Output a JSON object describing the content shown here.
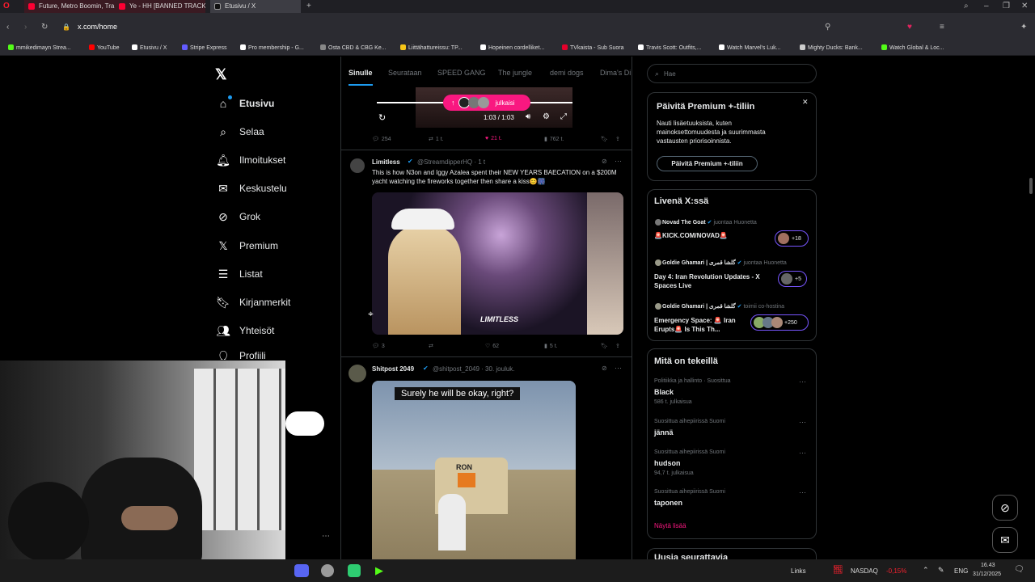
{
  "browser": {
    "tabs": [
      {
        "title": "Future, Metro Boomin, Tra",
        "color": "#e0245e"
      },
      {
        "title": "Ye - HH [BANNED TRACK]",
        "color": "#e0245e"
      },
      {
        "title": "Etusivu / X",
        "color": "#ffffff"
      }
    ],
    "url": "x.com/home",
    "bookmarks": [
      {
        "label": "mmikedimayn Strea...",
        "color": "#53fc18"
      },
      {
        "label": "YouTube",
        "color": "#ff0000"
      },
      {
        "label": "Etusivu / X",
        "color": "#ffffff"
      },
      {
        "label": "Stripe Express",
        "color": "#635bff"
      },
      {
        "label": "Pro membership - G...",
        "color": "#ffffff"
      },
      {
        "label": "Osta CBD & CBG Ke...",
        "color": "#888888"
      },
      {
        "label": "Liittähattureissu: TP...",
        "color": "#f5c518"
      },
      {
        "label": "Hopeinen cordelliket...",
        "color": "#ffffff"
      },
      {
        "label": "TVkaista - Sub Suora",
        "color": "#e4002b"
      },
      {
        "label": "Travis Scott: Outfits,...",
        "color": "#ffffff"
      },
      {
        "label": "Watch Marvel's Luk...",
        "color": "#ffffff"
      },
      {
        "label": "Mighty Ducks: Bank...",
        "color": "#cccccc"
      },
      {
        "label": "Watch Global & Loc...",
        "color": "#53fc18"
      }
    ]
  },
  "nav": {
    "items": [
      {
        "label": "Etusivu",
        "icon": "home-icon"
      },
      {
        "label": "Selaa",
        "icon": "search-icon"
      },
      {
        "label": "Ilmoitukset",
        "icon": "bell-icon"
      },
      {
        "label": "Keskustelu",
        "icon": "mail-icon"
      },
      {
        "label": "Grok",
        "icon": "grok-icon"
      },
      {
        "label": "Premium",
        "icon": "x-icon"
      },
      {
        "label": "Listat",
        "icon": "list-icon"
      },
      {
        "label": "Kirjanmerkit",
        "icon": "bookmark-icon"
      },
      {
        "label": "Yhteisöt",
        "icon": "people-icon"
      },
      {
        "label": "Profiili",
        "icon": "person-icon"
      }
    ]
  },
  "feed": {
    "tabs": [
      "Sinulle",
      "Seurataan",
      "SPEED GANG",
      "The jungle",
      "demi dogs",
      "Dima's Di"
    ],
    "video": {
      "posted_pill": "julkaisi",
      "time": "1:03 / 1:03",
      "replies": "254",
      "reposts": "1 t.",
      "likes": "21 t.",
      "views": "762 t."
    },
    "post1": {
      "name": "Limitless",
      "handle": "@StreamdipperHQ · 1 t",
      "text": "This is how N3on and Iggy Azalea spent their NEW YEARS BAECATION on a $200M yacht watching the fireworks together then share a kiss😊🎆",
      "image_caption": "LIMITLESS",
      "replies": "3",
      "reposts": "",
      "likes": "62",
      "views": "5 t."
    },
    "post2": {
      "name": "Shitpost 2049",
      "handle": "@shitpost_2049 · 30. jouluk.",
      "image_caption": "Surely he will be okay, right?",
      "truck_label": "RON"
    }
  },
  "sidebar": {
    "search_placeholder": "Hae",
    "premium": {
      "title": "Päivitä Premium +-tiliin",
      "body": "Nauti lisäetuuksista, kuten mainoksettomuudesta ja suurimmasta vastausten priorisoinnista.",
      "button": "Päivitä Premium +-tiliin"
    },
    "live": {
      "title": "Livenä X:ssä",
      "items": [
        {
          "host": "Novad The Goat",
          "role": "juontaa Huonetta",
          "title": "🚨KICK.COM/NOVAD🚨",
          "count": "+18"
        },
        {
          "host": "Goldie Ghamari | گلشا قمری",
          "role": "juontaa Huonetta",
          "title": "Day 4: Iran Revolution Updates - X Spaces Live",
          "count": "+5"
        },
        {
          "host": "Goldie Ghamari | گلشا قمری",
          "role": "toimii co-hostina",
          "title": "Emergency Space: 🚨 Iran Erupts🚨 Is This Th...",
          "count": "+250"
        }
      ]
    },
    "trends": {
      "title": "Mitä on tekeillä",
      "items": [
        {
          "meta": "Politiikka ja hallinto · Suosittua",
          "name": "Black",
          "count": "586 t. julkaisua"
        },
        {
          "meta": "Suosittua aihepiirissä Suomi",
          "name": "jännä",
          "count": ""
        },
        {
          "meta": "Suosittua aihepiirissä Suomi",
          "name": "hudson",
          "count": "94,7 t. julkaisua"
        },
        {
          "meta": "Suosittua aihepiirissä Suomi",
          "name": "taponen",
          "count": ""
        }
      ],
      "show_more": "Näytä lisää"
    },
    "next_heading": "Uusia seurattavia"
  },
  "taskbar": {
    "links": "Links",
    "ticker": "NASDAQ",
    "ticker_change": "-0,15%",
    "lang": "ENG",
    "time": "16.43",
    "date": "31/12/2025"
  },
  "colors": {
    "accent": "#1d9bf0",
    "pink": "#f91880",
    "trend_more": "#f91880",
    "ticker_neg": "#f4212e"
  }
}
